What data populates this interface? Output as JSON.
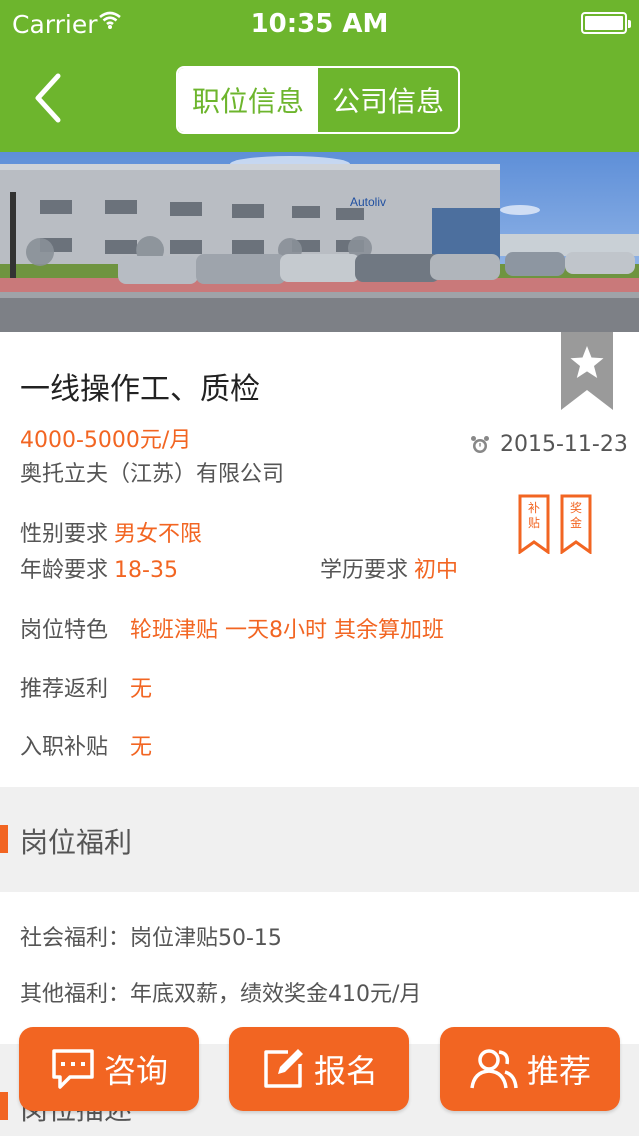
{
  "status": {
    "carrier": "Carrier",
    "time": "10:35 AM"
  },
  "nav": {
    "tabs": [
      {
        "label": "职位信息"
      },
      {
        "label": "公司信息"
      }
    ]
  },
  "job": {
    "title": "一线操作工、质检",
    "salary": "4000-5000元/月",
    "company": "奥托立夫（江苏）有限公司",
    "date": "2015-11-23",
    "gender_label": "性别要求",
    "gender_value": "男女不限",
    "age_label": "年龄要求",
    "age_value": "18-35",
    "edu_label": "学历要求",
    "edu_value": "初中",
    "feature_label": "岗位特色",
    "feature_value": "轮班津贴 一天8小时 其余算加班",
    "rebate_label": "推荐返利",
    "rebate_value": "无",
    "subsidy_label": "入职补贴",
    "subsidy_value": "无",
    "tags": [
      "补贴",
      "奖金"
    ]
  },
  "benefits": {
    "header": "岗位福利",
    "social": "社会福利：岗位津贴50-15",
    "other": "其他福利：年底双薪，绩效奖金410元/月"
  },
  "next_section": {
    "header": "岗位描述"
  },
  "actions": {
    "consult": "咨询",
    "apply": "报名",
    "recommend": "推荐"
  },
  "colors": {
    "brand_green": "#6db52d",
    "accent_orange": "#f26522"
  }
}
